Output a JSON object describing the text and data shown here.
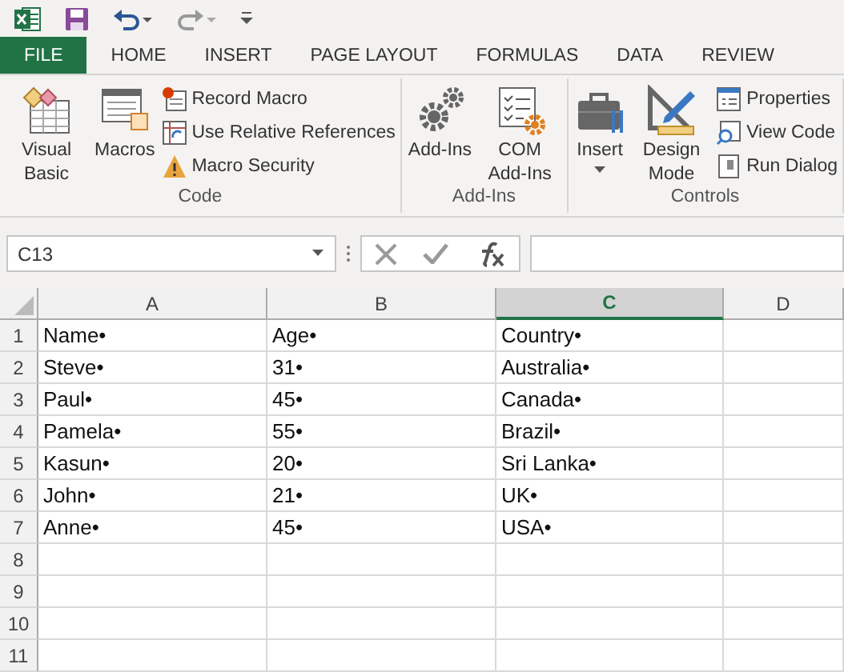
{
  "tabs": [
    {
      "label": "FILE",
      "kind": "file"
    },
    {
      "label": "HOME",
      "kind": "tab"
    },
    {
      "label": "INSERT",
      "kind": "tab"
    },
    {
      "label": "PAGE LAYOUT",
      "kind": "tab"
    },
    {
      "label": "FORMULAS",
      "kind": "tab"
    },
    {
      "label": "DATA",
      "kind": "tab"
    },
    {
      "label": "REVIEW",
      "kind": "tab"
    }
  ],
  "ribbon_groups": [
    {
      "name": "Code",
      "large": [
        {
          "label": "Visual Basic"
        },
        {
          "label": "Macros"
        }
      ],
      "small": [
        {
          "label": "Record Macro"
        },
        {
          "label": "Use Relative References"
        },
        {
          "label": "Macro Security"
        }
      ]
    },
    {
      "name": "Add-Ins",
      "large": [
        {
          "label": "Add-Ins"
        },
        {
          "label": "COM Add-Ins"
        }
      ]
    },
    {
      "name": "Controls",
      "large": [
        {
          "label": "Insert",
          "dropdown": true
        },
        {
          "label": "Design Mode",
          "dropdown": false
        }
      ],
      "small": [
        {
          "label": "Properties"
        },
        {
          "label": "View Code"
        },
        {
          "label": "Run Dialog"
        }
      ]
    }
  ],
  "name_box": {
    "value": "C13"
  },
  "columns": [
    {
      "label": "A",
      "selected": false
    },
    {
      "label": "B",
      "selected": false
    },
    {
      "label": "C",
      "selected": true
    },
    {
      "label": "D",
      "selected": false
    }
  ],
  "rows": [
    {
      "number": "1",
      "cells": [
        "Name•",
        "Age•",
        "Country•"
      ]
    },
    {
      "number": "2",
      "cells": [
        "Steve•",
        "31•",
        "Australia•"
      ]
    },
    {
      "number": "3",
      "cells": [
        "Paul•",
        "45•",
        "Canada•"
      ]
    },
    {
      "number": "4",
      "cells": [
        "Pamela•",
        "55•",
        "Brazil•"
      ]
    },
    {
      "number": "5",
      "cells": [
        "Kasun•",
        "20•",
        "Sri Lanka•"
      ]
    },
    {
      "number": "6",
      "cells": [
        "John•",
        "21•",
        "UK•"
      ]
    },
    {
      "number": "7",
      "cells": [
        "Anne•",
        "45•",
        "USA•"
      ]
    },
    {
      "number": "8"
    },
    {
      "number": "9"
    },
    {
      "number": "10"
    },
    {
      "number": "11"
    }
  ]
}
